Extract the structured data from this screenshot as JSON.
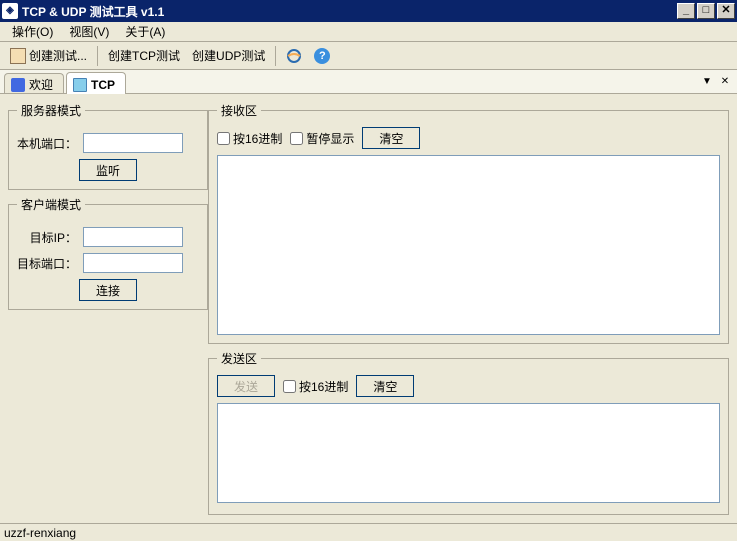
{
  "title": "TCP & UDP 测试工具 v1.1",
  "menu": {
    "operation": "操作(O)",
    "view": "视图(V)",
    "about": "关于(A)"
  },
  "toolbar": {
    "createTest": "创建测试...",
    "createTcpTest": "创建TCP测试",
    "createUdpTest": "创建UDP测试"
  },
  "tabs": {
    "welcome": "欢迎",
    "tcp": "TCP"
  },
  "serverMode": {
    "legend": "服务器模式",
    "localPortLabel": "本机端口：",
    "localPortValue": "",
    "listenBtn": "监听"
  },
  "clientMode": {
    "legend": "客户端模式",
    "targetIpLabel": "目标IP：",
    "targetIpValue": "",
    "targetPortLabel": "目标端口：",
    "targetPortValue": "",
    "connectBtn": "连接"
  },
  "receive": {
    "legend": "接收区",
    "hexLabel": "按16进制",
    "pauseLabel": "暂停显示",
    "clearBtn": "清空",
    "content": ""
  },
  "send": {
    "legend": "发送区",
    "sendBtn": "发送",
    "hexLabel": "按16进制",
    "clearBtn": "清空",
    "content": ""
  },
  "statusbar": "uzzf-renxiang"
}
